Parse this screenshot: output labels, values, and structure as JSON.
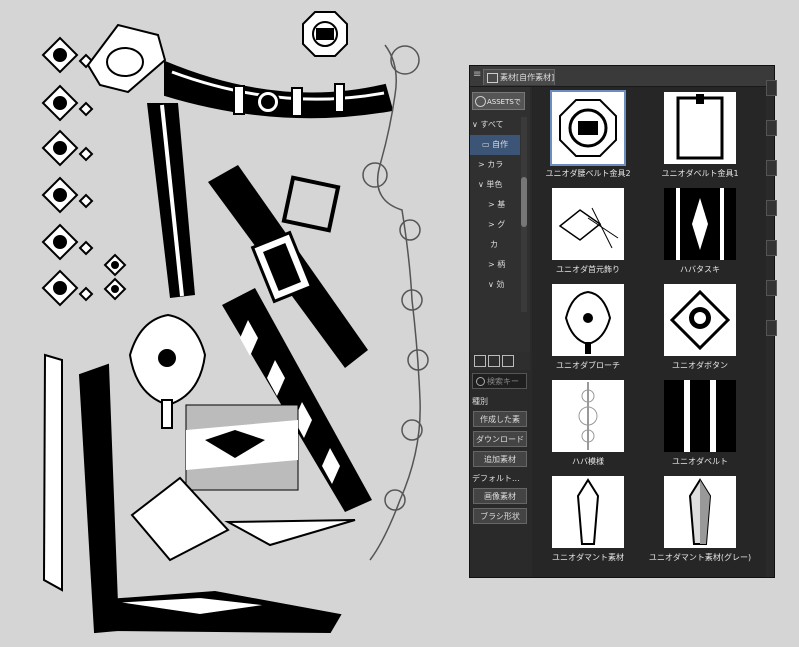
{
  "panel": {
    "menu_icon": "hamburger-icon",
    "tab_label": "素材[自作素材]",
    "assets_label": "ASSETSで",
    "tree": [
      {
        "label": "すべて",
        "state": "expanded"
      },
      {
        "label": "自作",
        "state": "selected"
      },
      {
        "label": "カラ",
        "state": "collapsed"
      },
      {
        "label": "単色",
        "state": "expanded"
      },
      {
        "label": "基",
        "state": "collapsed"
      },
      {
        "label": "グ",
        "state": "collapsed"
      },
      {
        "label": "カ",
        "state": "leaf"
      },
      {
        "label": "柄",
        "state": "collapsed"
      },
      {
        "label": "効",
        "state": "expanded"
      },
      {
        "label": "",
        "state": "leaf"
      },
      {
        "label": "",
        "state": "leaf"
      }
    ],
    "search_placeholder": "検索キー",
    "type_heading": "種別",
    "type_filters": [
      "作成した素",
      "ダウンロード",
      "追加素材"
    ],
    "default_heading": "デフォルト...",
    "default_filters": [
      "画像素材",
      "ブラシ形状"
    ],
    "assets": [
      {
        "label": "ユニオダ腰ベルト金具2",
        "icon": "belt-buckle-round"
      },
      {
        "label": "ユニオダベルト金具1",
        "icon": "belt-buckle-square"
      },
      {
        "label": "ユニオダ首元飾り",
        "icon": "neck-ornament"
      },
      {
        "label": "ハバタスキ",
        "icon": "sash-pattern"
      },
      {
        "label": "ユニオダブローチ",
        "icon": "brooch"
      },
      {
        "label": "ユニオダボタン",
        "icon": "button-diamond"
      },
      {
        "label": "ハバ模様",
        "icon": "lace-pattern"
      },
      {
        "label": "ユニオダベルト",
        "icon": "belt-stripes"
      },
      {
        "label": "ユニオダマント素材",
        "icon": "mantle-crystal"
      },
      {
        "label": "ユニオダマント素材(グレー)",
        "icon": "mantle-crystal-grey"
      }
    ]
  }
}
